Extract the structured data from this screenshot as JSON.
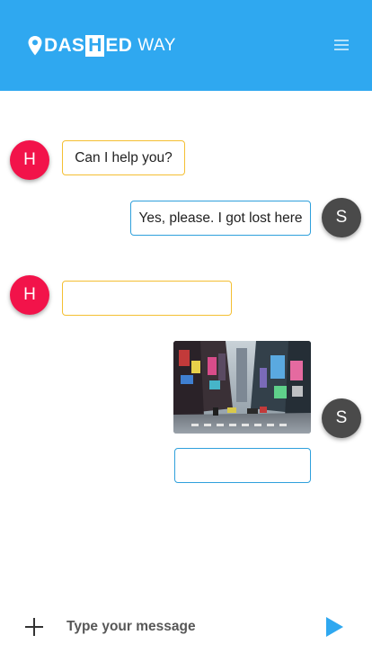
{
  "header": {
    "logo": {
      "part1": "DAS",
      "boxed": "H",
      "part2": "ED",
      "part3": "WAY"
    },
    "menu_icon": "hamburger-menu-icon",
    "color": "#2fa8f0"
  },
  "messages": [
    {
      "sender": "H",
      "direction": "incoming",
      "text": "Can I help you?"
    },
    {
      "sender": "S",
      "direction": "outgoing",
      "text": "Yes, please. I got lost here"
    },
    {
      "sender": "H",
      "direction": "incoming",
      "text": ""
    },
    {
      "sender": "S",
      "direction": "outgoing",
      "type": "image",
      "image": "city-street-photo"
    },
    {
      "sender": "S",
      "direction": "outgoing",
      "text": ""
    }
  ],
  "avatars": {
    "helper_initial": "H",
    "user_initial": "S"
  },
  "colors": {
    "helper_avatar": "#f2134a",
    "user_avatar": "#4a4a4a",
    "incoming_border": "#f4bf32",
    "outgoing_border": "#2fa0dc"
  },
  "composer": {
    "placeholder": "Type your message",
    "attach_icon": "plus-icon",
    "send_icon": "send-arrow-icon"
  }
}
